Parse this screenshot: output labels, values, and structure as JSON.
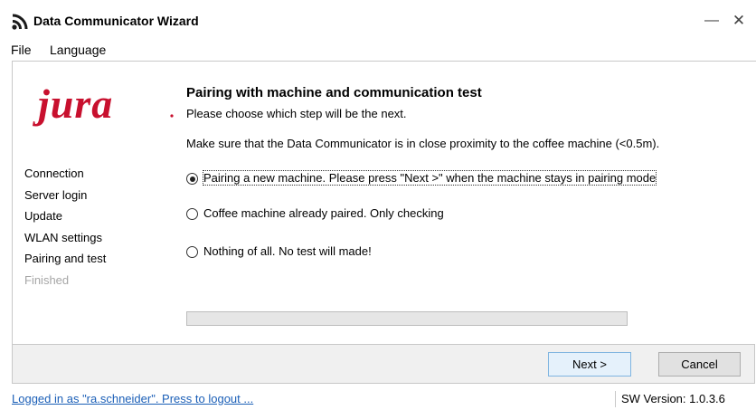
{
  "window": {
    "title": "Data Communicator Wizard",
    "minimize": "—",
    "close": "✕"
  },
  "menu": {
    "items": [
      "File",
      "Language"
    ]
  },
  "brand": {
    "logo_text": "jura",
    "logo_color": "#c8102e"
  },
  "steps": [
    {
      "label": "Connection",
      "enabled": true
    },
    {
      "label": "Server login",
      "enabled": true
    },
    {
      "label": "Update",
      "enabled": true
    },
    {
      "label": "WLAN settings",
      "enabled": true
    },
    {
      "label": "Pairing and test",
      "enabled": true
    },
    {
      "label": "Finished",
      "enabled": false
    }
  ],
  "page": {
    "heading": "Pairing with machine and communication test",
    "subheading": "Please choose which step will be the next.",
    "note": "Make sure that the Data Communicator is in close proximity to the coffee machine (<0.5m).",
    "options": [
      {
        "label": "Pairing a new machine. Please press \"Next >\" when the machine stays in pairing mode",
        "checked": true
      },
      {
        "label": "Coffee machine already paired. Only checking",
        "checked": false
      },
      {
        "label": "Nothing of all. No test will made!",
        "checked": false
      }
    ],
    "progress": 0
  },
  "buttons": {
    "next": "Next >",
    "cancel": "Cancel"
  },
  "status": {
    "logout_text": "Logged in as \"ra.schneider\". Press to logout ...",
    "version": "SW Version:  1.0.3.6"
  }
}
